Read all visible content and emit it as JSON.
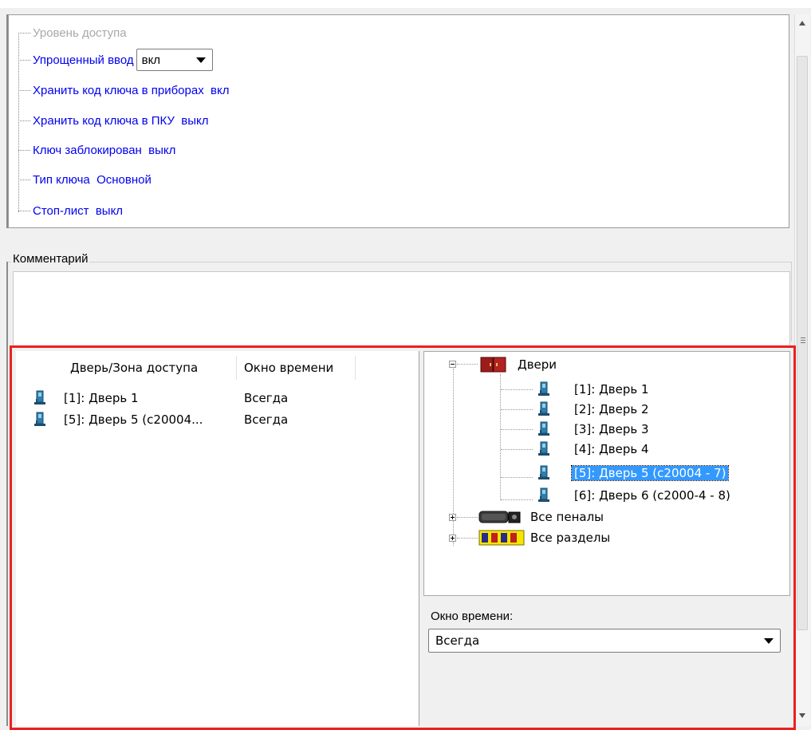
{
  "properties": {
    "access_level": "Уровень доступа",
    "simplified_input_label": "Упрощенный ввод",
    "simplified_input_value": "вкл",
    "store_in_devices": "Хранить код ключа в приборах  вкл",
    "store_in_pku": "Хранить код ключа в ПКУ  выкл",
    "key_blocked": "Ключ заблокирован  выкл",
    "key_type": "Тип ключа  Основной",
    "stop_list": "Стоп-лист  выкл"
  },
  "comment": {
    "label": "Комментарий",
    "value": ""
  },
  "access_list": {
    "columns": [
      "Дверь/Зона доступа",
      "Окно времени"
    ],
    "rows": [
      {
        "door": "[1]: Дверь 1",
        "window": "Всегда",
        "icon": "door-icon"
      },
      {
        "door": "[5]: Дверь 5 (c20004...",
        "window": "Всегда",
        "icon": "door-icon"
      }
    ]
  },
  "tree": {
    "doors_root": "Двери",
    "doors": [
      "[1]: Дверь 1",
      "[2]: Дверь 2",
      "[3]: Дверь 3",
      "[4]: Дверь 4",
      "[5]: Дверь 5 (c20004 - 7)",
      "[6]: Дверь 6 (c2000-4 - 8)"
    ],
    "selected_index": 4,
    "all_cases": "Все пеналы",
    "all_sections": "Все разделы"
  },
  "time_window": {
    "label": "Окно времени:",
    "value": "Всегда"
  },
  "colors": {
    "highlight": "#ea2020",
    "link": "#0000f0",
    "selection": "#3399ff"
  }
}
